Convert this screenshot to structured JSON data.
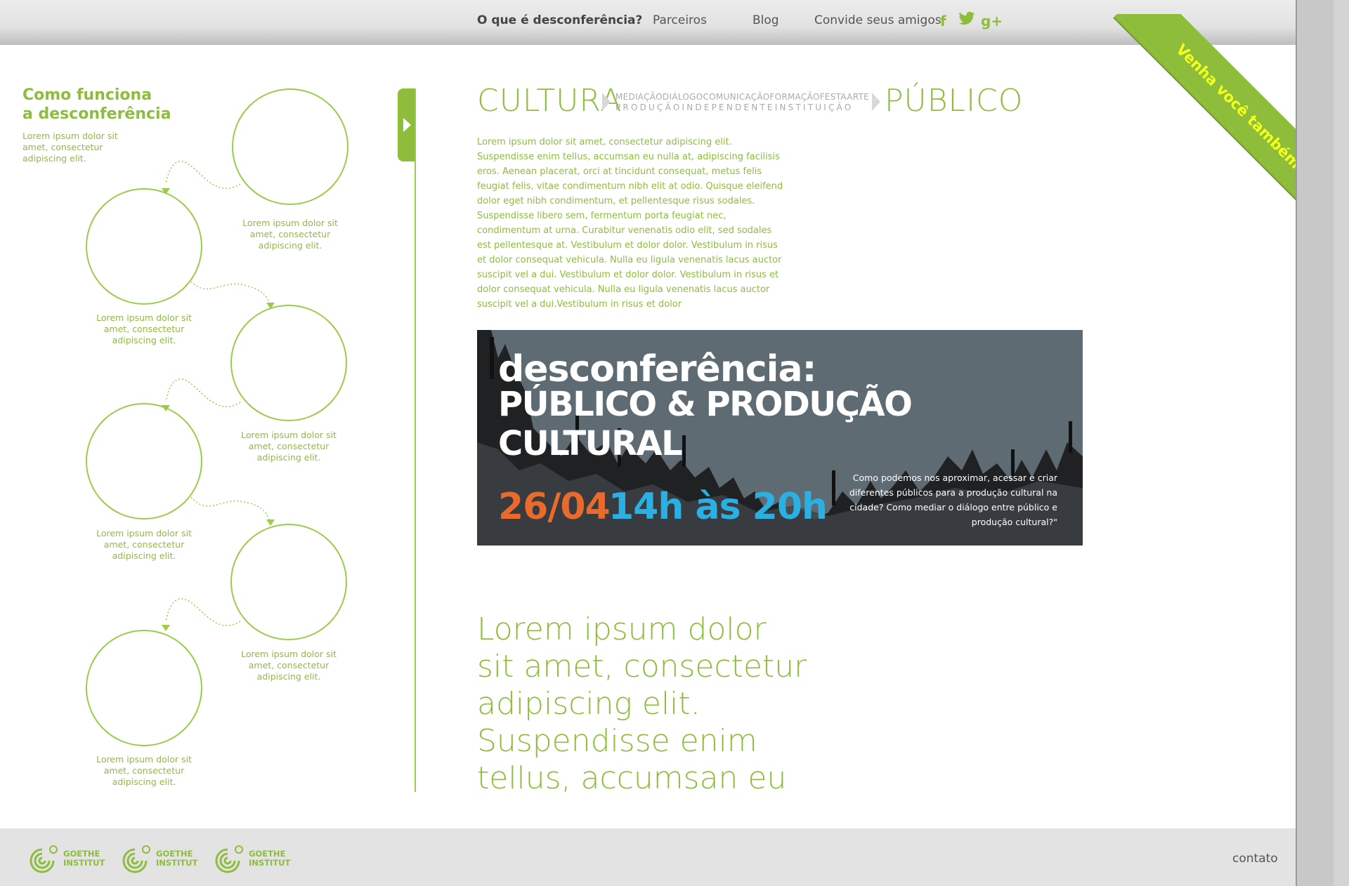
{
  "nav": {
    "what_is": "O que é desconferência?",
    "partners": "Parceiros",
    "blog": "Blog",
    "invite": "Convide seus amigos:",
    "social_icons": [
      "facebook-icon",
      "twitter-icon",
      "google-plus-icon"
    ]
  },
  "ribbon": {
    "label": "Venha você também!"
  },
  "sidebar": {
    "title_line1": "Como funciona",
    "title_line2": "a desconferência",
    "subtitle": "Lorem ipsum dolor sit amet, consectetur adipiscing elit.",
    "steps": [
      "Lorem ipsum dolor sit amet, consectetur adipiscing elit.",
      "Lorem ipsum dolor sit amet, consectetur adipiscing elit.",
      "Lorem ipsum dolor sit amet, consectetur adipiscing elit.",
      "Lorem ipsum dolor sit amet, consectetur adipiscing elit.",
      "Lorem ipsum dolor sit amet, consectetur adipiscing elit.",
      "Lorem ipsum dolor sit amet, consectetur adipiscing elit."
    ]
  },
  "keywords": {
    "left": "CULTURA",
    "middle_top": "MEDIAÇÃODIÁLOGOCOMUNICAÇÃOFORMAÇÃOFESTAARTE",
    "middle_bottom": "PRODUÇÃOINDEPENDENTEINSTITUIÇÃO",
    "right": "PÚBLICO"
  },
  "intro_text": "Lorem ipsum dolor sit amet, consectetur adipiscing elit. Suspendisse enim tellus, accumsan eu nulla at, adipiscing facilisis eros. Aenean placerat, orci at tincidunt consequat, metus felis feugiat felis, vitae condimentum nibh elit at odio. Quisque eleifend dolor eget nibh condimentum, et pellentesque risus sodales. Suspendisse libero sem, fermentum porta feugiat nec, condimentum at urna. Curabitur venenatis odio elit, sed sodales est pellentesque at. Vestibulum et dolor dolor. Vestibulum in risus et dolor consequat vehicula. Nulla eu ligula venenatis lacus auctor suscipit vel a dui. Vestibulum et dolor dolor. Vestibulum in risus et dolor consequat vehicula. Nulla eu ligula venenatis lacus auctor suscipit vel a dui.Vestibulum in risus et dolor",
  "banner": {
    "title_line1": "desconferência:",
    "title_line2": "PÚBLICO & PRODUÇÃO CULTURAL",
    "date": "26/04",
    "time": "14h às 20h",
    "question": "Como podemos nos aproximar, acessar e criar diferentes públicos para a produção cultural na cidade? Como mediar o diálogo entre público e produção cultural?\""
  },
  "quote": "Lorem ipsum dolor sit amet, consectetur adipiscing elit. Suspendisse enim tellus, accumsan eu",
  "footer": {
    "logos": [
      {
        "line1": "GOETHE",
        "line2": "INSTITUT"
      },
      {
        "line1": "GOETHE",
        "line2": "INSTITUT"
      },
      {
        "line1": "GOETHE",
        "line2": "INSTITUT"
      }
    ],
    "contact": "contato"
  },
  "colors": {
    "brand_green": "#8dbd3b",
    "banner_bg": "#5e6b72",
    "date_orange": "#e96a2b",
    "time_blue": "#2bb0e3",
    "ribbon_text": "#f4ff1a"
  }
}
